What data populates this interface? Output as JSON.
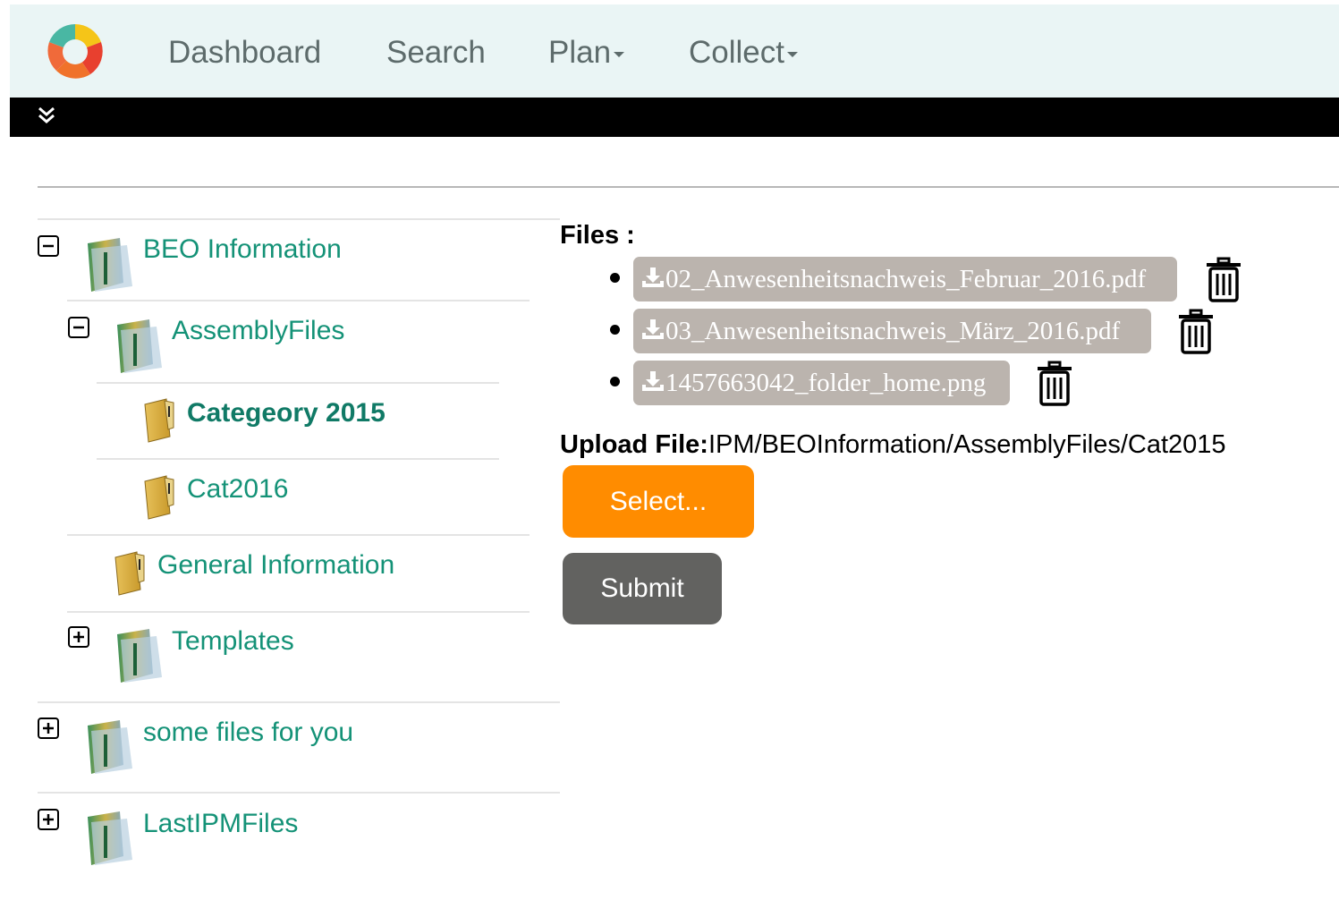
{
  "nav": {
    "items": [
      {
        "label": "Dashboard",
        "dropdown": false
      },
      {
        "label": "Search",
        "dropdown": false
      },
      {
        "label": "Plan",
        "dropdown": true
      },
      {
        "label": "Collect",
        "dropdown": true
      }
    ]
  },
  "tree": {
    "beo": {
      "label": "BEO Information",
      "expanded": true
    },
    "assembly": {
      "label": "AssemblyFiles",
      "expanded": true
    },
    "categeory": {
      "label": "Categeory 2015",
      "selected": true
    },
    "cat2016": {
      "label": "Cat2016"
    },
    "general": {
      "label": "General Information"
    },
    "templates": {
      "label": "Templates",
      "expanded": false
    },
    "somefiles": {
      "label": "some files for you",
      "expanded": false
    },
    "lastipm": {
      "label": "LastIPMFiles",
      "expanded": false
    }
  },
  "files": {
    "title": "Files :",
    "items": [
      {
        "name": "02_Anwesenheitsnachweis_Februar_2016.pdf"
      },
      {
        "name": "03_Anwesenheitsnachweis_März_2016.pdf"
      },
      {
        "name": "1457663042_folder_home.png"
      }
    ]
  },
  "upload": {
    "label": "Upload File:",
    "path": "IPM/BEOInformation/AssemblyFiles/Cat2015"
  },
  "buttons": {
    "select": "Select...",
    "submit": "Submit"
  },
  "colors": {
    "accent_green": "#149277",
    "select_orange": "#ff8c00",
    "submit_gray": "#626260",
    "chip_gray": "#bbb4ae",
    "navbar_bg": "#eaf5f5"
  }
}
